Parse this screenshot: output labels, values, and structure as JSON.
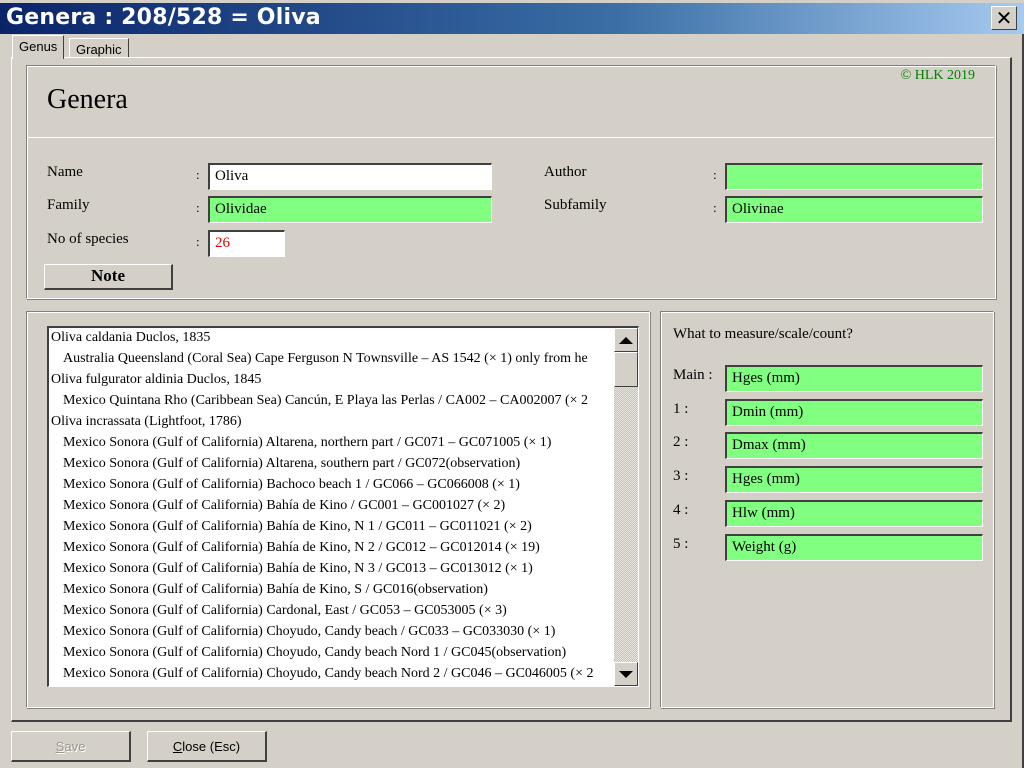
{
  "window": {
    "title": "Genera : 208/528 = Oliva",
    "close_icon": "close-x-icon"
  },
  "tabs": [
    {
      "label": "Genus",
      "active": true
    },
    {
      "label": "Graphic",
      "active": false
    }
  ],
  "header": {
    "heading": "Genera",
    "copyright": "© HLK 2019"
  },
  "fields": {
    "name": {
      "label": "Name",
      "value": "Oliva"
    },
    "family": {
      "label": "Family",
      "value": "Olividae"
    },
    "species_count": {
      "label": "No of species",
      "value": "26"
    },
    "author": {
      "label": "Author",
      "value": ""
    },
    "subfamily": {
      "label": "Subfamily",
      "value": "Olivinae"
    },
    "colon": ":"
  },
  "buttons": {
    "note": "Note",
    "save_prefix": "S",
    "save_rest": "ave",
    "close_prefix": "C",
    "close_rest": "lose (Esc)"
  },
  "species_list": [
    {
      "text": "Oliva caldania Duclos, 1835",
      "level": 0
    },
    {
      "text": "Australia Queensland (Coral Sea) Cape Ferguson N Townsville – AS 1542 (× 1) only from he",
      "level": 1
    },
    {
      "text": "Oliva fulgurator aldinia Duclos, 1845",
      "level": 0
    },
    {
      "text": "Mexico Quintana Rho (Caribbean Sea) Cancún, E Playa las Perlas / CA002 – CA002007 (× 2",
      "level": 1
    },
    {
      "text": "Oliva incrassata (Lightfoot, 1786)",
      "level": 0
    },
    {
      "text": "Mexico Sonora (Gulf of California) Altarena, northern part / GC071 – GC071005 (× 1)",
      "level": 1
    },
    {
      "text": "Mexico Sonora (Gulf of California) Altarena, southern part / GC072(observation)",
      "level": 1
    },
    {
      "text": "Mexico Sonora (Gulf of California) Bachoco beach 1 / GC066 – GC066008 (× 1)",
      "level": 1
    },
    {
      "text": "Mexico Sonora (Gulf of California) Bahía de Kino / GC001 – GC001027 (× 2)",
      "level": 1
    },
    {
      "text": "Mexico Sonora (Gulf of California) Bahía de Kino, N 1 / GC011 – GC011021 (× 2)",
      "level": 1
    },
    {
      "text": "Mexico Sonora (Gulf of California) Bahía de Kino, N 2 / GC012 – GC012014 (× 19)",
      "level": 1
    },
    {
      "text": "Mexico Sonora (Gulf of California) Bahía de Kino, N 3 / GC013 – GC013012 (× 1)",
      "level": 1
    },
    {
      "text": "Mexico Sonora (Gulf of California) Bahía de Kino, S / GC016(observation)",
      "level": 1
    },
    {
      "text": "Mexico Sonora (Gulf of California) Cardonal, East / GC053 – GC053005 (× 3)",
      "level": 1
    },
    {
      "text": "Mexico Sonora (Gulf of California) Choyudo, Candy beach / GC033 – GC033030 (× 1)",
      "level": 1
    },
    {
      "text": "Mexico Sonora (Gulf of California) Choyudo, Candy beach Nord 1 / GC045(observation)",
      "level": 1
    },
    {
      "text": "Mexico Sonora (Gulf of California) Choyudo, Candy beach Nord 2 / GC046 – GC046005 (× 2",
      "level": 1
    }
  ],
  "measure": {
    "title": "What to measure/scale/count?",
    "rows": [
      {
        "label": "Main :",
        "value": "Hges (mm)"
      },
      {
        "label": "1 :",
        "value": "Dmin (mm)"
      },
      {
        "label": "2 :",
        "value": "Dmax (mm)"
      },
      {
        "label": "3 :",
        "value": "Hges (mm)"
      },
      {
        "label": "4 :",
        "value": "Hlw (mm)"
      },
      {
        "label": "5 :",
        "value": "Weight (g)"
      }
    ]
  },
  "colors": {
    "title_gradient_start": "#0a246a",
    "title_gradient_end": "#a6caf0",
    "field_green": "#80ff80",
    "copyright_green": "#008000",
    "count_red": "#e00000",
    "face": "#d4d0c8"
  }
}
